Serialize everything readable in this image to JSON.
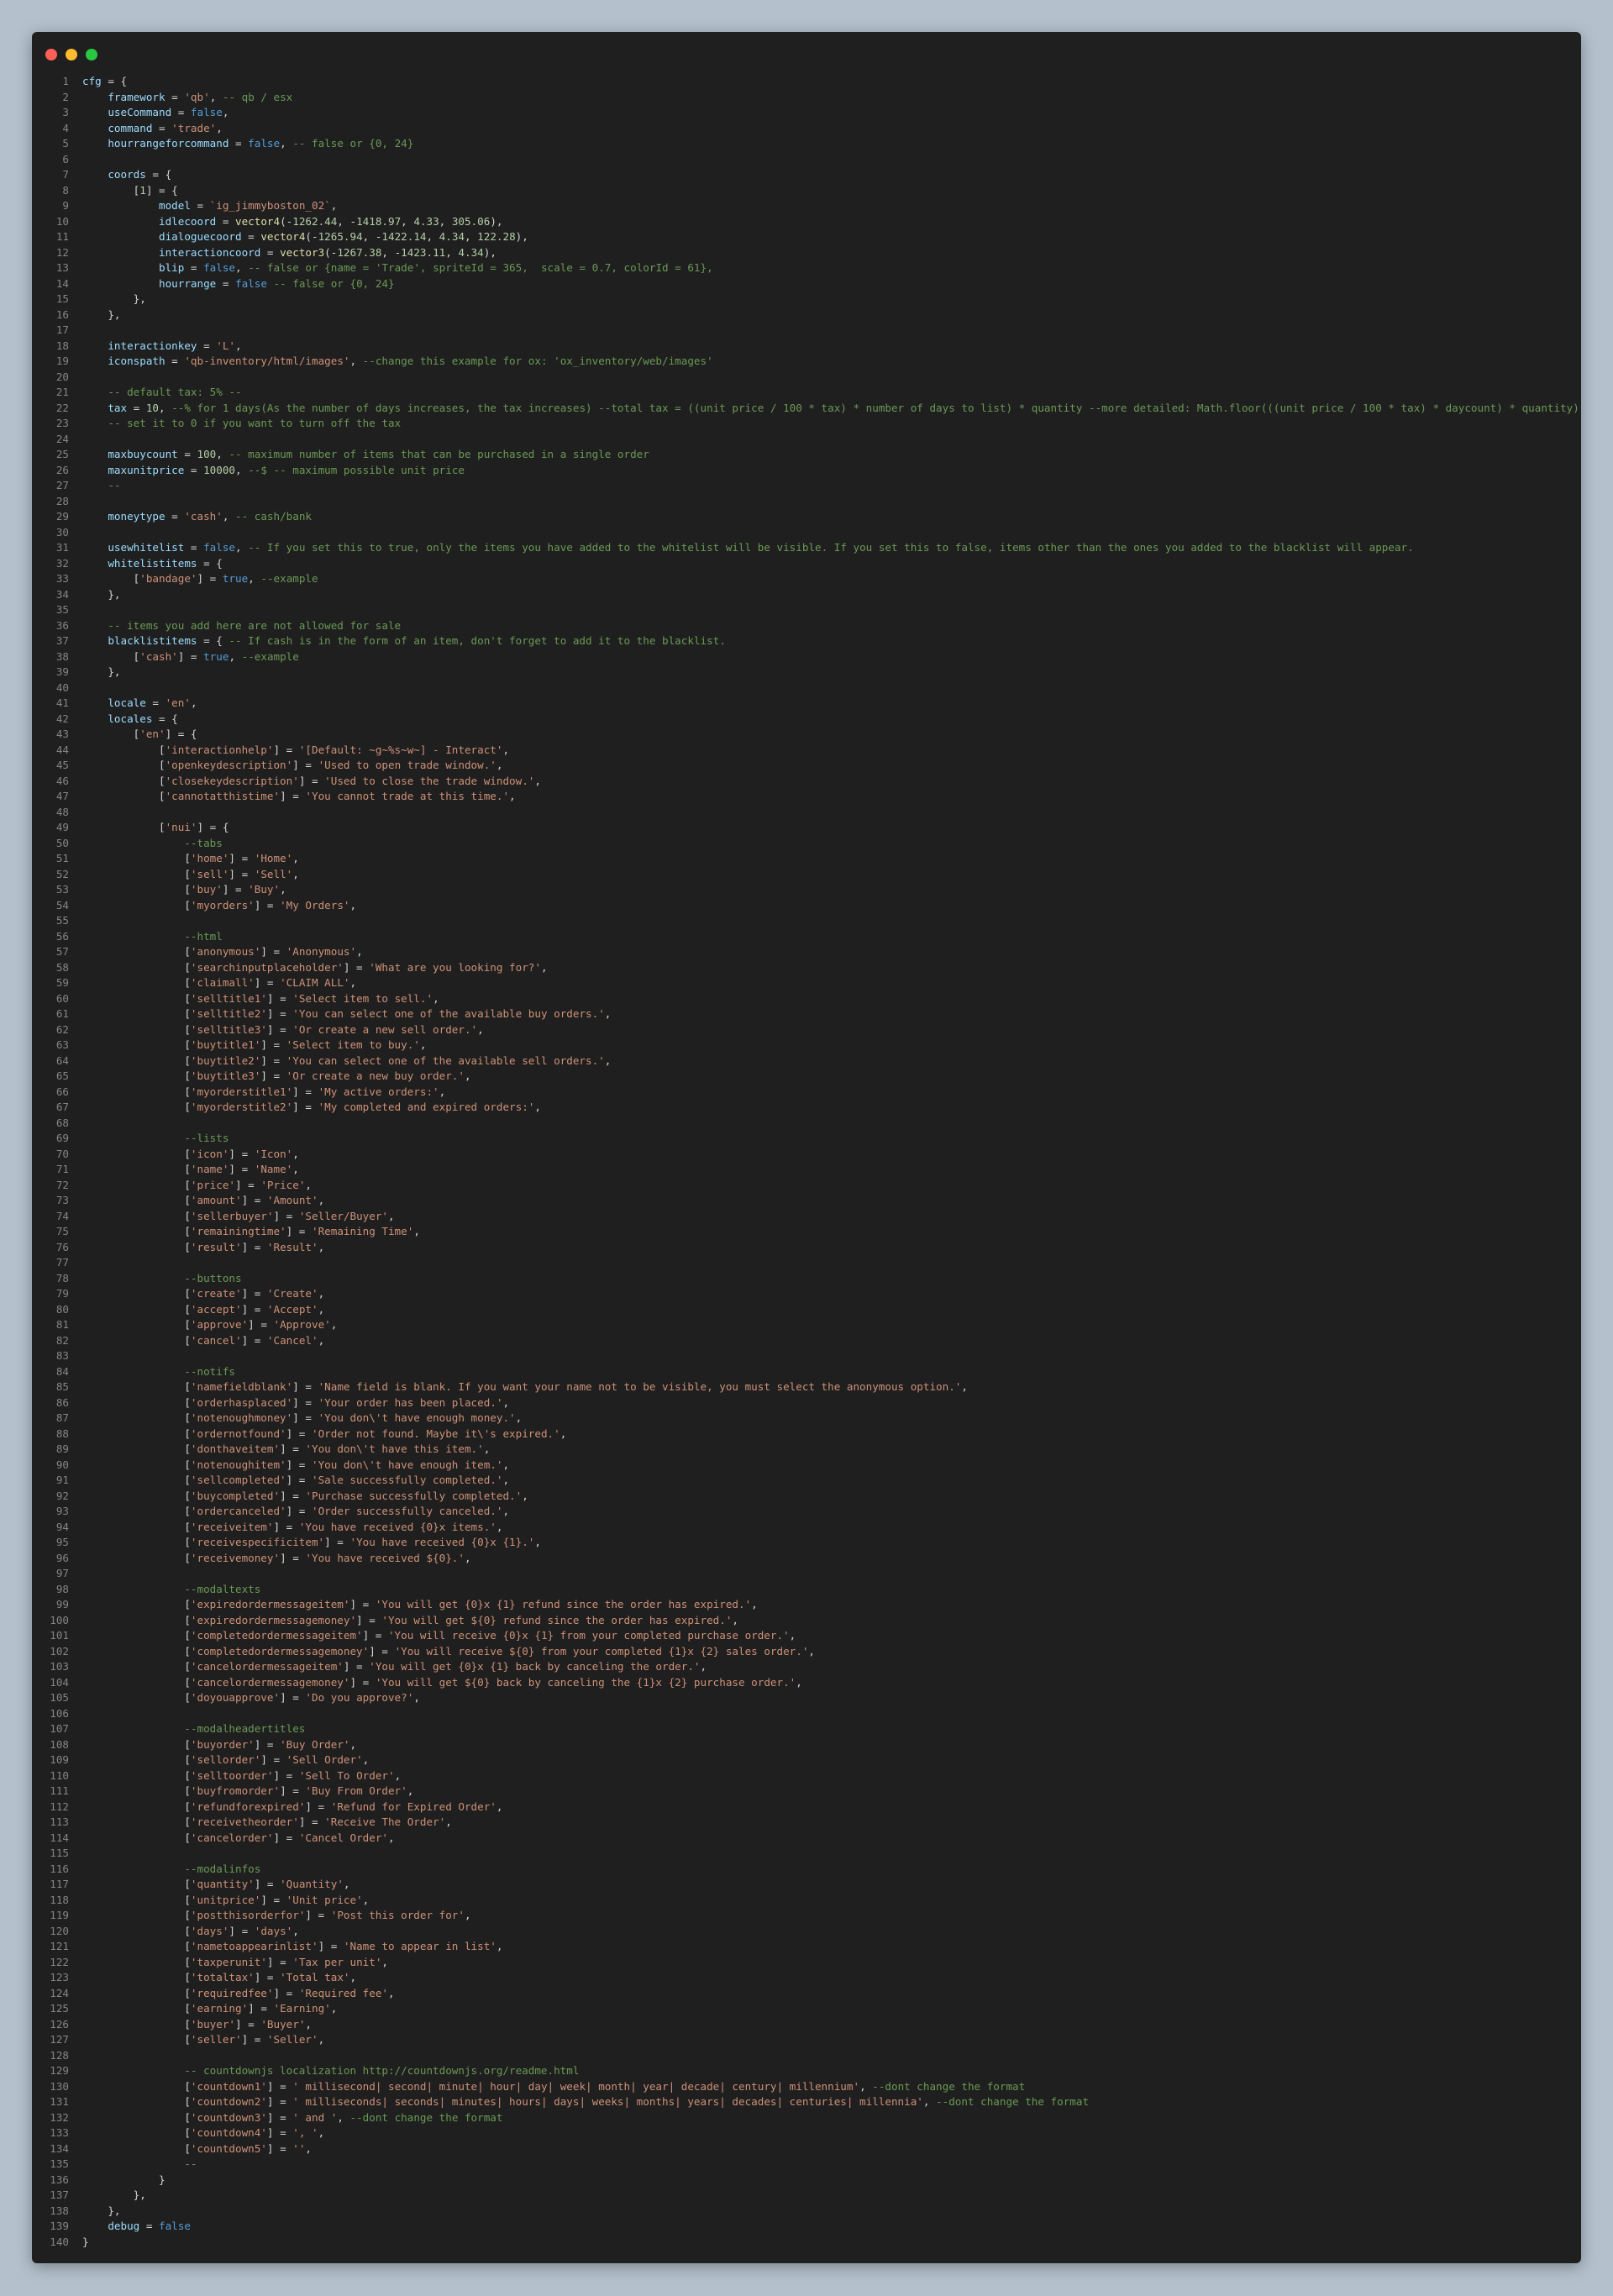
{
  "window": {
    "buttons": [
      "close",
      "minimize",
      "maximize"
    ],
    "colors": {
      "background": "#1f1f1f",
      "close": "#ff5f57",
      "minimize": "#febc2e",
      "maximize": "#28c840"
    }
  },
  "editor": {
    "language": "lua",
    "colors": {
      "text": "#d4d4d4",
      "line_number": "#858585",
      "identifier": "#9cdcfe",
      "string": "#ce9178",
      "comment": "#6a9955",
      "keyword": "#569cd6",
      "number": "#b5cea8"
    },
    "lines": [
      "cfg = {",
      "    framework = 'qb', -- qb / esx",
      "    useCommand = false,",
      "    command = 'trade',",
      "    hourrangeforcommand = false, -- false or {0, 24}",
      "",
      "    coords = {",
      "        [1] = {",
      "            model = `ig_jimmyboston_02`,",
      "            idlecoord = vector4(-1262.44, -1418.97, 4.33, 305.06),",
      "            dialoguecoord = vector4(-1265.94, -1422.14, 4.34, 122.28),",
      "            interactioncoord = vector3(-1267.38, -1423.11, 4.34),",
      "            blip = false, -- false or {name = 'Trade', spriteId = 365,  scale = 0.7, colorId = 61},",
      "            hourrange = false -- false or {0, 24}",
      "        },",
      "    },",
      "",
      "    interactionkey = 'L',",
      "    iconspath = 'qb-inventory/html/images', --change this example for ox: 'ox_inventory/web/images'",
      "",
      "    -- default tax: 5% --",
      "    tax = 10, --% for 1 days(As the number of days increases, the tax increases) --total tax = ((unit price / 100 * tax) * number of days to list) * quantity --more detailed: Math.floor(((unit price / 100 * tax) * daycount) * quantity)",
      "    -- set it to 0 if you want to turn off the tax",
      "",
      "    maxbuycount = 100, -- maximum number of items that can be purchased in a single order",
      "    maxunitprice = 10000, --$ -- maximum possible unit price",
      "    --",
      "",
      "    moneytype = 'cash', -- cash/bank",
      "",
      "    usewhitelist = false, -- If you set this to true, only the items you have added to the whitelist will be visible. If you set this to false, items other than the ones you added to the blacklist will appear.",
      "    whitelistitems = {",
      "        ['bandage'] = true, --example",
      "    },",
      "",
      "    -- items you add here are not allowed for sale",
      "    blacklistitems = { -- If cash is in the form of an item, don't forget to add it to the blacklist.",
      "        ['cash'] = true, --example",
      "    },",
      "",
      "    locale = 'en',",
      "    locales = {",
      "        ['en'] = {",
      "            ['interactionhelp'] = '[Default: ~g~%s~w~] - Interact',",
      "            ['openkeydescription'] = 'Used to open trade window.',",
      "            ['closekeydescription'] = 'Used to close the trade window.',",
      "            ['cannotatthistime'] = 'You cannot trade at this time.',",
      "",
      "            ['nui'] = {",
      "                --tabs",
      "                ['home'] = 'Home',",
      "                ['sell'] = 'Sell',",
      "                ['buy'] = 'Buy',",
      "                ['myorders'] = 'My Orders',",
      "",
      "                --html",
      "                ['anonymous'] = 'Anonymous',",
      "                ['searchinputplaceholder'] = 'What are you looking for?',",
      "                ['claimall'] = 'CLAIM ALL',",
      "                ['selltitle1'] = 'Select item to sell.',",
      "                ['selltitle2'] = 'You can select one of the available buy orders.',",
      "                ['selltitle3'] = 'Or create a new sell order.',",
      "                ['buytitle1'] = 'Select item to buy.',",
      "                ['buytitle2'] = 'You can select one of the available sell orders.',",
      "                ['buytitle3'] = 'Or create a new buy order.',",
      "                ['myorderstitle1'] = 'My active orders:',",
      "                ['myorderstitle2'] = 'My completed and expired orders:',",
      "",
      "                --lists",
      "                ['icon'] = 'Icon',",
      "                ['name'] = 'Name',",
      "                ['price'] = 'Price',",
      "                ['amount'] = 'Amount',",
      "                ['sellerbuyer'] = 'Seller/Buyer',",
      "                ['remainingtime'] = 'Remaining Time',",
      "                ['result'] = 'Result',",
      "",
      "                --buttons",
      "                ['create'] = 'Create',",
      "                ['accept'] = 'Accept',",
      "                ['approve'] = 'Approve',",
      "                ['cancel'] = 'Cancel',",
      "",
      "                --notifs",
      "                ['namefieldblank'] = 'Name field is blank. If you want your name not to be visible, you must select the anonymous option.',",
      "                ['orderhasplaced'] = 'Your order has been placed.',",
      "                ['notenoughmoney'] = 'You don\\'t have enough money.',",
      "                ['ordernotfound'] = 'Order not found. Maybe it\\'s expired.',",
      "                ['donthaveitem'] = 'You don\\'t have this item.',",
      "                ['notenoughitem'] = 'You don\\'t have enough item.',",
      "                ['sellcompleted'] = 'Sale successfully completed.',",
      "                ['buycompleted'] = 'Purchase successfully completed.',",
      "                ['ordercanceled'] = 'Order successfully canceled.',",
      "                ['receiveitem'] = 'You have received {0}x items.',",
      "                ['receivespecificitem'] = 'You have received {0}x {1}.',",
      "                ['receivemoney'] = 'You have received ${0}.',",
      "",
      "                --modaltexts",
      "                ['expiredordermessageitem'] = 'You will get {0}x {1} refund since the order has expired.',",
      "                ['expiredordermessagemoney'] = 'You will get ${0} refund since the order has expired.',",
      "                ['completedordermessageitem'] = 'You will receive {0}x {1} from your completed purchase order.',",
      "                ['completedordermessagemoney'] = 'You will receive ${0} from your completed {1}x {2} sales order.',",
      "                ['cancelordermessageitem'] = 'You will get {0}x {1} back by canceling the order.',",
      "                ['cancelordermessagemoney'] = 'You will get ${0} back by canceling the {1}x {2} purchase order.',",
      "                ['doyouapprove'] = 'Do you approve?',",
      "",
      "                --modalheadertitles",
      "                ['buyorder'] = 'Buy Order',",
      "                ['sellorder'] = 'Sell Order',",
      "                ['selltoorder'] = 'Sell To Order',",
      "                ['buyfromorder'] = 'Buy From Order',",
      "                ['refundforexpired'] = 'Refund for Expired Order',",
      "                ['receivetheorder'] = 'Receive The Order',",
      "                ['cancelorder'] = 'Cancel Order',",
      "",
      "                --modalinfos",
      "                ['quantity'] = 'Quantity',",
      "                ['unitprice'] = 'Unit price',",
      "                ['postthisorderfor'] = 'Post this order for',",
      "                ['days'] = 'days',",
      "                ['nametoappearinlist'] = 'Name to appear in list',",
      "                ['taxperunit'] = 'Tax per unit',",
      "                ['totaltax'] = 'Total tax',",
      "                ['requiredfee'] = 'Required fee',",
      "                ['earning'] = 'Earning',",
      "                ['buyer'] = 'Buyer',",
      "                ['seller'] = 'Seller',",
      "",
      "                -- countdownjs localization http://countdownjs.org/readme.html",
      "                ['countdown1'] = ' millisecond| second| minute| hour| day| week| month| year| decade| century| millennium', --dont change the format",
      "                ['countdown2'] = ' milliseconds| seconds| minutes| hours| days| weeks| months| years| decades| centuries| millennia', --dont change the format",
      "                ['countdown3'] = ' and ', --dont change the format",
      "                ['countdown4'] = ', ',",
      "                ['countdown5'] = '',",
      "                --",
      "            }",
      "        },",
      "    },",
      "    debug = false",
      "}"
    ]
  }
}
